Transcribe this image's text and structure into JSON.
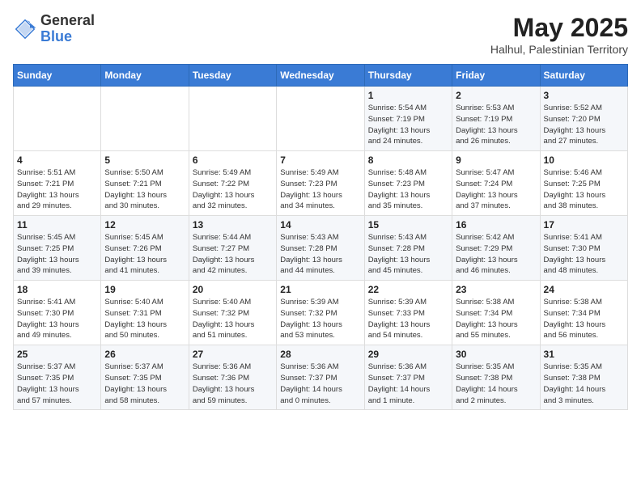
{
  "logo": {
    "general": "General",
    "blue": "Blue"
  },
  "header": {
    "month_year": "May 2025",
    "location": "Halhul, Palestinian Territory"
  },
  "days_of_week": [
    "Sunday",
    "Monday",
    "Tuesday",
    "Wednesday",
    "Thursday",
    "Friday",
    "Saturday"
  ],
  "weeks": [
    [
      {
        "day": "",
        "info": ""
      },
      {
        "day": "",
        "info": ""
      },
      {
        "day": "",
        "info": ""
      },
      {
        "day": "",
        "info": ""
      },
      {
        "day": "1",
        "info": "Sunrise: 5:54 AM\nSunset: 7:19 PM\nDaylight: 13 hours\nand 24 minutes."
      },
      {
        "day": "2",
        "info": "Sunrise: 5:53 AM\nSunset: 7:19 PM\nDaylight: 13 hours\nand 26 minutes."
      },
      {
        "day": "3",
        "info": "Sunrise: 5:52 AM\nSunset: 7:20 PM\nDaylight: 13 hours\nand 27 minutes."
      }
    ],
    [
      {
        "day": "4",
        "info": "Sunrise: 5:51 AM\nSunset: 7:21 PM\nDaylight: 13 hours\nand 29 minutes."
      },
      {
        "day": "5",
        "info": "Sunrise: 5:50 AM\nSunset: 7:21 PM\nDaylight: 13 hours\nand 30 minutes."
      },
      {
        "day": "6",
        "info": "Sunrise: 5:49 AM\nSunset: 7:22 PM\nDaylight: 13 hours\nand 32 minutes."
      },
      {
        "day": "7",
        "info": "Sunrise: 5:49 AM\nSunset: 7:23 PM\nDaylight: 13 hours\nand 34 minutes."
      },
      {
        "day": "8",
        "info": "Sunrise: 5:48 AM\nSunset: 7:23 PM\nDaylight: 13 hours\nand 35 minutes."
      },
      {
        "day": "9",
        "info": "Sunrise: 5:47 AM\nSunset: 7:24 PM\nDaylight: 13 hours\nand 37 minutes."
      },
      {
        "day": "10",
        "info": "Sunrise: 5:46 AM\nSunset: 7:25 PM\nDaylight: 13 hours\nand 38 minutes."
      }
    ],
    [
      {
        "day": "11",
        "info": "Sunrise: 5:45 AM\nSunset: 7:25 PM\nDaylight: 13 hours\nand 39 minutes."
      },
      {
        "day": "12",
        "info": "Sunrise: 5:45 AM\nSunset: 7:26 PM\nDaylight: 13 hours\nand 41 minutes."
      },
      {
        "day": "13",
        "info": "Sunrise: 5:44 AM\nSunset: 7:27 PM\nDaylight: 13 hours\nand 42 minutes."
      },
      {
        "day": "14",
        "info": "Sunrise: 5:43 AM\nSunset: 7:28 PM\nDaylight: 13 hours\nand 44 minutes."
      },
      {
        "day": "15",
        "info": "Sunrise: 5:43 AM\nSunset: 7:28 PM\nDaylight: 13 hours\nand 45 minutes."
      },
      {
        "day": "16",
        "info": "Sunrise: 5:42 AM\nSunset: 7:29 PM\nDaylight: 13 hours\nand 46 minutes."
      },
      {
        "day": "17",
        "info": "Sunrise: 5:41 AM\nSunset: 7:30 PM\nDaylight: 13 hours\nand 48 minutes."
      }
    ],
    [
      {
        "day": "18",
        "info": "Sunrise: 5:41 AM\nSunset: 7:30 PM\nDaylight: 13 hours\nand 49 minutes."
      },
      {
        "day": "19",
        "info": "Sunrise: 5:40 AM\nSunset: 7:31 PM\nDaylight: 13 hours\nand 50 minutes."
      },
      {
        "day": "20",
        "info": "Sunrise: 5:40 AM\nSunset: 7:32 PM\nDaylight: 13 hours\nand 51 minutes."
      },
      {
        "day": "21",
        "info": "Sunrise: 5:39 AM\nSunset: 7:32 PM\nDaylight: 13 hours\nand 53 minutes."
      },
      {
        "day": "22",
        "info": "Sunrise: 5:39 AM\nSunset: 7:33 PM\nDaylight: 13 hours\nand 54 minutes."
      },
      {
        "day": "23",
        "info": "Sunrise: 5:38 AM\nSunset: 7:34 PM\nDaylight: 13 hours\nand 55 minutes."
      },
      {
        "day": "24",
        "info": "Sunrise: 5:38 AM\nSunset: 7:34 PM\nDaylight: 13 hours\nand 56 minutes."
      }
    ],
    [
      {
        "day": "25",
        "info": "Sunrise: 5:37 AM\nSunset: 7:35 PM\nDaylight: 13 hours\nand 57 minutes."
      },
      {
        "day": "26",
        "info": "Sunrise: 5:37 AM\nSunset: 7:35 PM\nDaylight: 13 hours\nand 58 minutes."
      },
      {
        "day": "27",
        "info": "Sunrise: 5:36 AM\nSunset: 7:36 PM\nDaylight: 13 hours\nand 59 minutes."
      },
      {
        "day": "28",
        "info": "Sunrise: 5:36 AM\nSunset: 7:37 PM\nDaylight: 14 hours\nand 0 minutes."
      },
      {
        "day": "29",
        "info": "Sunrise: 5:36 AM\nSunset: 7:37 PM\nDaylight: 14 hours\nand 1 minute."
      },
      {
        "day": "30",
        "info": "Sunrise: 5:35 AM\nSunset: 7:38 PM\nDaylight: 14 hours\nand 2 minutes."
      },
      {
        "day": "31",
        "info": "Sunrise: 5:35 AM\nSunset: 7:38 PM\nDaylight: 14 hours\nand 3 minutes."
      }
    ]
  ]
}
